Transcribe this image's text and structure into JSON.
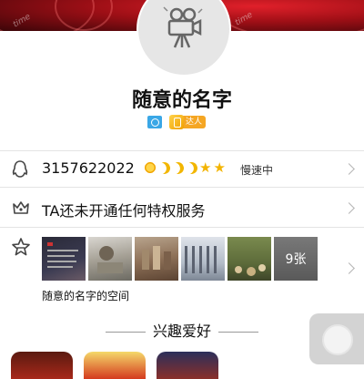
{
  "banner": {
    "watermark_left": "time",
    "watermark_right": "time"
  },
  "profile": {
    "name": "随意的名字",
    "vip_badge_label": "达人"
  },
  "qq_row": {
    "number": "3157622022",
    "speed_status": "慢速中"
  },
  "privilege_row": {
    "text": "TA还未开通任何特权服务"
  },
  "space_row": {
    "label": "随意的名字的空间",
    "photo_count": "9张"
  },
  "interest": {
    "title": "兴趣爱好"
  },
  "colors": {
    "banner_red": "#c0141c",
    "star_gold": "#f3b400",
    "badge_blue": "#3aa7e6",
    "vip_orange": "#f5a623"
  },
  "icons": [
    "camera-icon",
    "qq-penguin-icon",
    "crown-icon",
    "star-outline-icon",
    "chevron-right-icon"
  ]
}
